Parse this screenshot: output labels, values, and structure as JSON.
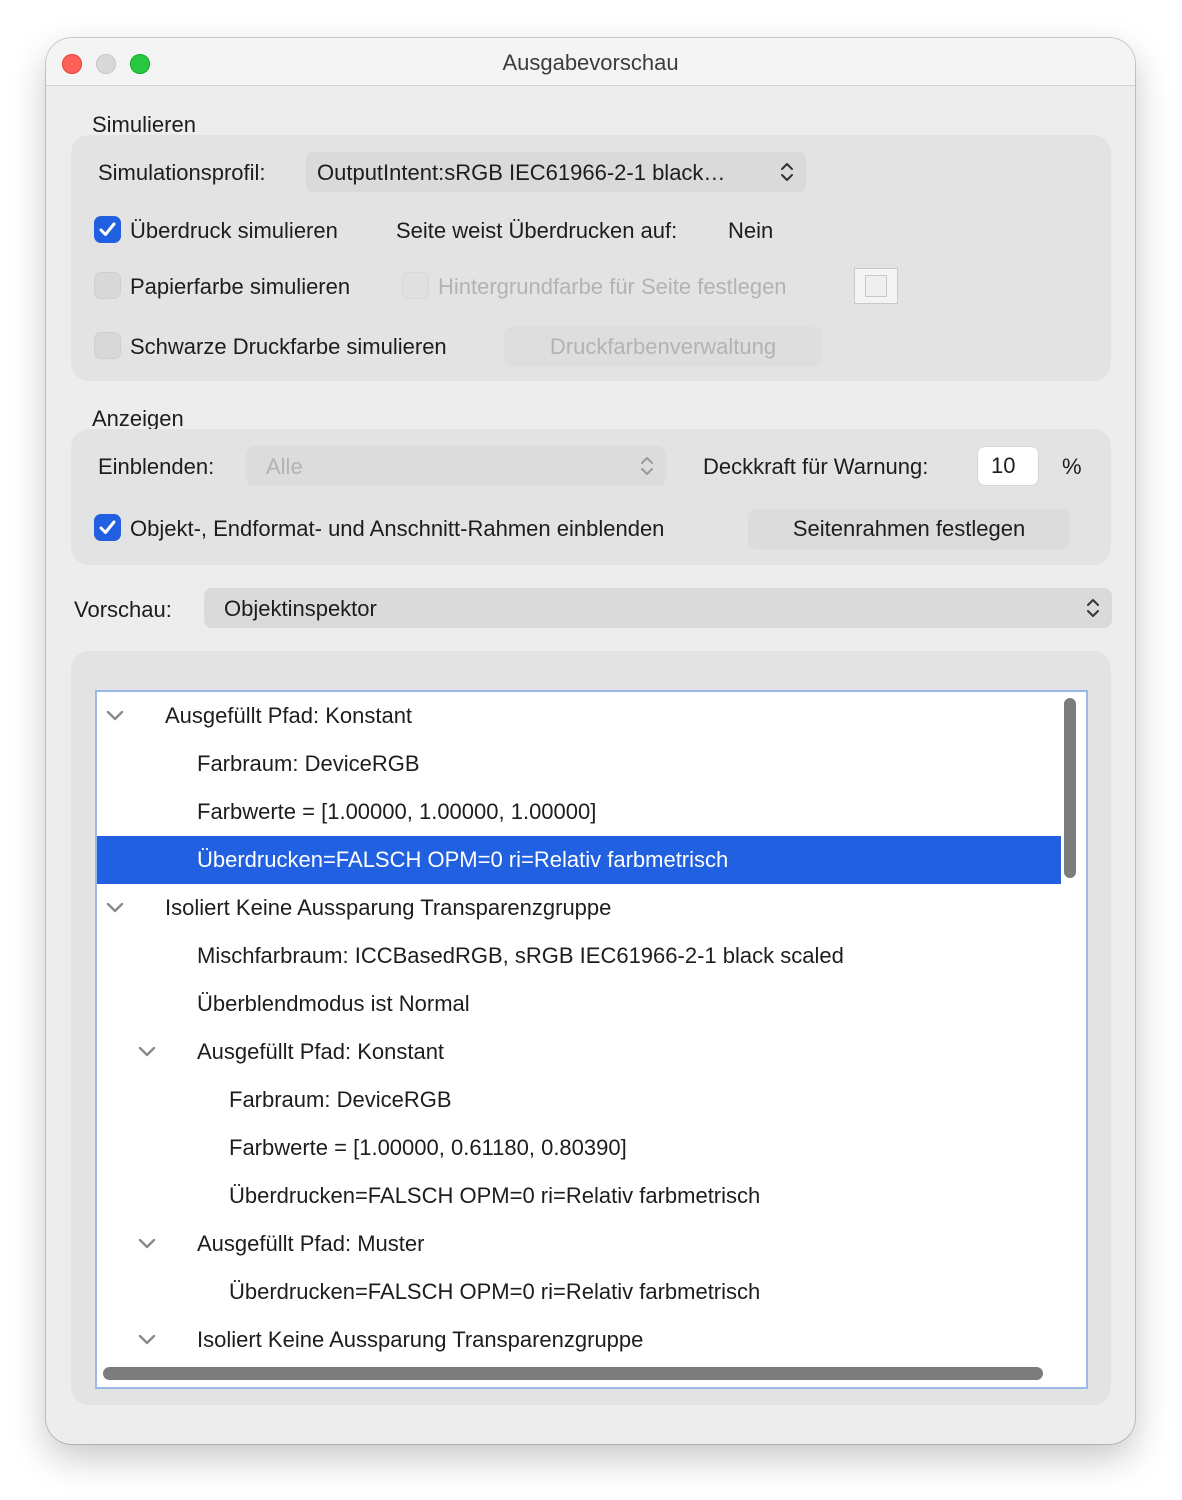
{
  "window": {
    "title": "Ausgabevorschau"
  },
  "simulate": {
    "section_label": "Simulieren",
    "profile_label": "Simulationsprofil:",
    "profile_value": "OutputIntent:sRGB IEC61966-2-1 black…",
    "overprint_label": "Überdruck simulieren",
    "overprint_checked": true,
    "page_overprint_label": "Seite weist Überdrucken auf:",
    "page_overprint_value": "Nein",
    "paper_color_label": "Papierfarbe simulieren",
    "paper_color_checked": false,
    "background_color_label": "Hintergrundfarbe für Seite festlegen",
    "black_ink_label": "Schwarze Druckfarbe simulieren",
    "black_ink_checked": false,
    "ink_manager_label": "Druckfarbenverwaltung"
  },
  "display": {
    "section_label": "Anzeigen",
    "show_label": "Einblenden:",
    "show_value": "Alle",
    "warning_opacity_label": "Deckkraft für Warnung:",
    "warning_opacity_value": "10",
    "percent_unit": "%",
    "frames_label": "Objekt-, Endformat- und Anschnitt-Rahmen einblenden",
    "frames_checked": true,
    "page_boxes_button": "Seitenrahmen festlegen"
  },
  "preview": {
    "label": "Vorschau:",
    "value": "Objektinspektor"
  },
  "tree": {
    "rows": [
      {
        "label": "Ausgefüllt Pfad: Konstant",
        "level": 0,
        "expandable": true,
        "selected": false
      },
      {
        "label": "Farbraum: DeviceRGB",
        "level": 1,
        "expandable": false,
        "selected": false
      },
      {
        "label": "Farbwerte = [1.00000, 1.00000, 1.00000]",
        "level": 1,
        "expandable": false,
        "selected": false
      },
      {
        "label": "Überdrucken=FALSCH OPM=0 ri=Relativ farbmetrisch",
        "level": 1,
        "expandable": false,
        "selected": true
      },
      {
        "label": "Isoliert Keine Aussparung Transparenzgruppe",
        "level": 0,
        "expandable": true,
        "selected": false
      },
      {
        "label": "Mischfarbraum: ICCBasedRGB, sRGB IEC61966-2-1 black scaled",
        "level": 1,
        "expandable": false,
        "selected": false
      },
      {
        "label": "Überblendmodus ist Normal",
        "level": 1,
        "expandable": false,
        "selected": false
      },
      {
        "label": "Ausgefüllt Pfad: Konstant",
        "level": 1,
        "expandable": true,
        "selected": false
      },
      {
        "label": "Farbraum: DeviceRGB",
        "level": 2,
        "expandable": false,
        "selected": false
      },
      {
        "label": "Farbwerte = [1.00000, 0.61180, 0.80390]",
        "level": 2,
        "expandable": false,
        "selected": false
      },
      {
        "label": "Überdrucken=FALSCH OPM=0 ri=Relativ farbmetrisch",
        "level": 2,
        "expandable": false,
        "selected": false
      },
      {
        "label": "Ausgefüllt Pfad: Muster",
        "level": 1,
        "expandable": true,
        "selected": false
      },
      {
        "label": "Überdrucken=FALSCH OPM=0 ri=Relativ farbmetrisch",
        "level": 2,
        "expandable": false,
        "selected": false
      },
      {
        "label": "Isoliert Keine Aussparung Transparenzgruppe",
        "level": 1,
        "expandable": true,
        "selected": false
      }
    ]
  },
  "colors": {
    "accent": "#2160e0",
    "close": "#ff5f57",
    "zoom": "#28c840"
  }
}
